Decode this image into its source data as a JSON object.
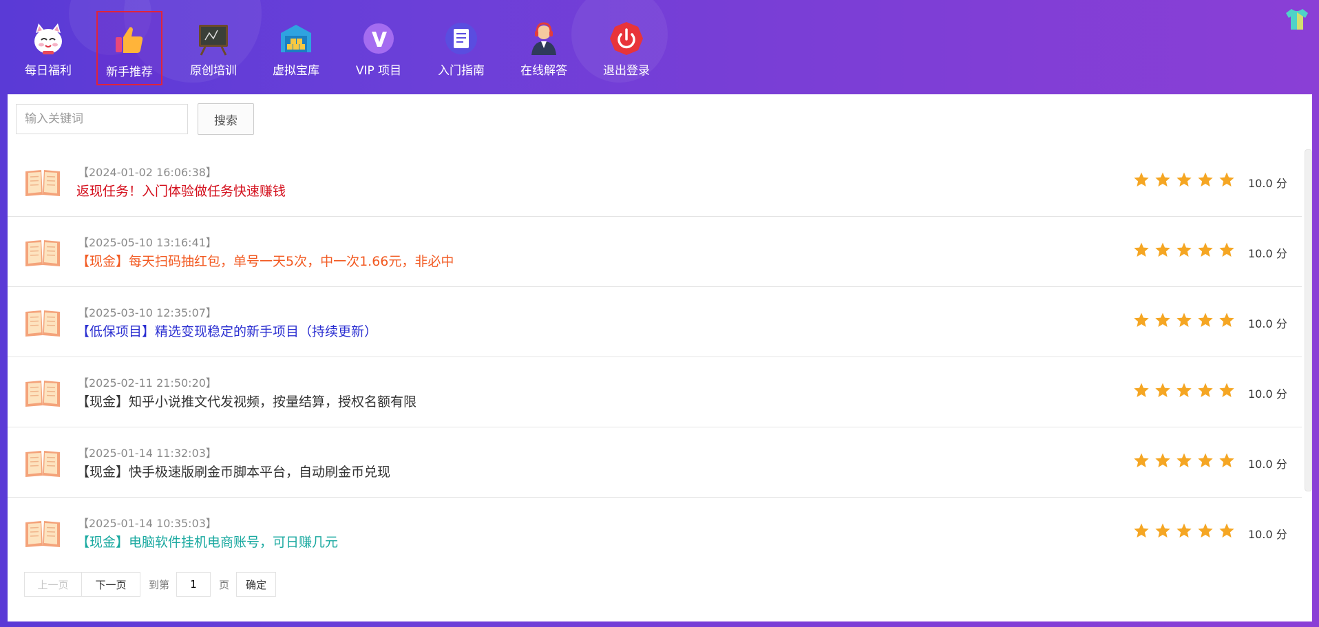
{
  "nav": [
    {
      "label": "每日福利",
      "icon": "lucky-cat-icon"
    },
    {
      "label": "新手推荐",
      "icon": "thumbs-up-icon",
      "active": true
    },
    {
      "label": "原创培训",
      "icon": "blackboard-icon"
    },
    {
      "label": "虚拟宝库",
      "icon": "warehouse-icon"
    },
    {
      "label": "VIP 项目",
      "icon": "vip-icon"
    },
    {
      "label": "入门指南",
      "icon": "document-icon"
    },
    {
      "label": "在线解答",
      "icon": "support-agent-icon"
    },
    {
      "label": "退出登录",
      "icon": "power-icon"
    }
  ],
  "search": {
    "placeholder": "输入关键词",
    "button": "搜索"
  },
  "items": [
    {
      "date": "【2024-01-02 16:06:38】",
      "title": "返现任务！入门体验做任务快速赚钱",
      "color": "#d4111e",
      "rating": 5,
      "score": "10.0 分"
    },
    {
      "date": "【2025-05-10 13:16:41】",
      "title": "【现金】每天扫码抽红包，单号一天5次，中一次1.66元，非必中",
      "color": "#f25a22",
      "rating": 5,
      "score": "10.0 分"
    },
    {
      "date": "【2025-03-10 12:35:07】",
      "title": "【低保项目】精选变现稳定的新手项目（持续更新）",
      "color": "#2b2fd1",
      "rating": 5,
      "score": "10.0 分"
    },
    {
      "date": "【2025-02-11 21:50:20】",
      "title": "【现金】知乎小说推文代发视频，按量结算，授权名额有限",
      "color": "#333333",
      "rating": 5,
      "score": "10.0 分"
    },
    {
      "date": "【2025-01-14 11:32:03】",
      "title": "【现金】快手极速版刷金币脚本平台，自动刷金币兑现",
      "color": "#333333",
      "rating": 5,
      "score": "10.0 分"
    },
    {
      "date": "【2025-01-14 10:35:03】",
      "title": "【现金】电脑软件挂机电商账号，可日赚几元",
      "color": "#1aa9a0",
      "rating": 5,
      "score": "10.0 分"
    }
  ],
  "pager": {
    "prev": "上一页",
    "next": "下一页",
    "goto": "到第",
    "page": "1",
    "unit": "页",
    "ok": "确定"
  },
  "colors": {
    "accent": "#6a3fd8",
    "star": "#f5a623",
    "active_border": "#e0243a"
  }
}
